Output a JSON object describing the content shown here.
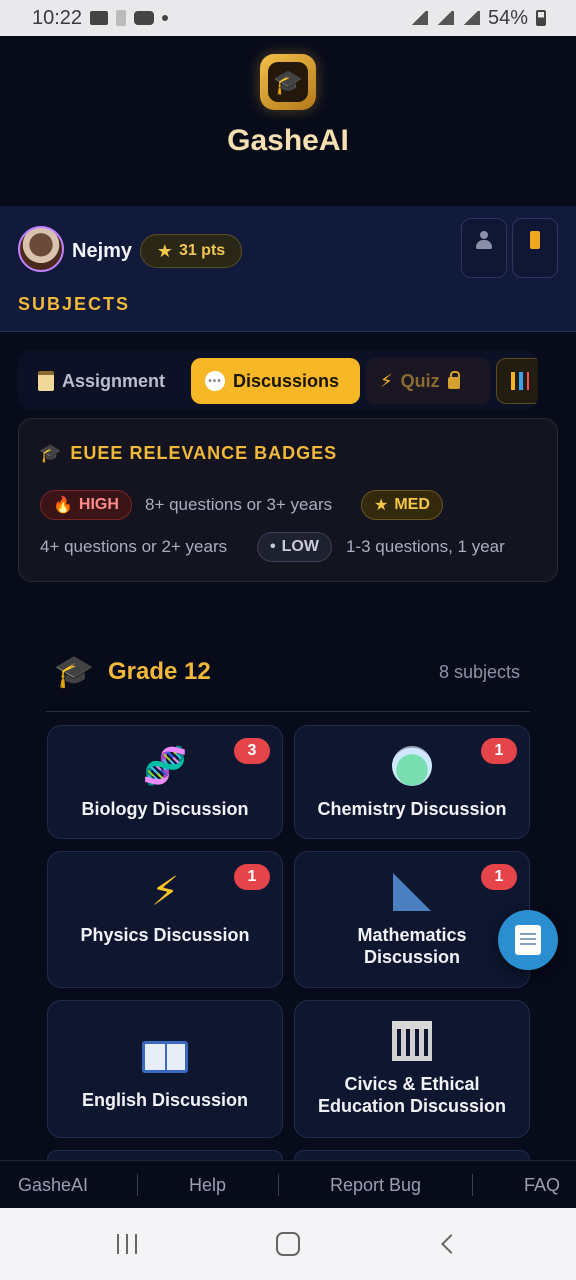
{
  "status_bar": {
    "time": "10:22",
    "battery": "54%"
  },
  "app": {
    "title": "GasheAI"
  },
  "user": {
    "name": "Nejmy",
    "points": "31 pts"
  },
  "section": {
    "label": "SUBJECTS"
  },
  "tabs": [
    {
      "label": "Assignment",
      "icon": "clipboard-icon"
    },
    {
      "label": "Discussions",
      "icon": "speech-bubble-icon",
      "active": true
    },
    {
      "label": "Quiz",
      "icon": "lightning-icon",
      "locked": true
    },
    {
      "label": "",
      "icon": "bar-chart-icon"
    }
  ],
  "relevance": {
    "title": "EUEE RELEVANCE BADGES",
    "high_label": "HIGH",
    "high_desc": "8+ questions or 3+ years",
    "med_label": "MED",
    "med_desc": "4+ questions or 2+ years",
    "low_label": "LOW",
    "low_desc": "1-3 questions, 1 year"
  },
  "grade": {
    "title": "Grade 12",
    "count": "8 subjects"
  },
  "subjects": [
    {
      "title": "Biology Discussion",
      "badge": "3",
      "icon": "dna-icon"
    },
    {
      "title": "Chemistry Discussion",
      "badge": "1",
      "icon": "flask-icon"
    },
    {
      "title": "Physics Discussion",
      "badge": "1",
      "icon": "lightning-icon"
    },
    {
      "title": "Mathematics Discussion",
      "badge": "1",
      "icon": "triangle-ruler-icon"
    },
    {
      "title": "English Discussion",
      "badge": "",
      "icon": "open-book-icon"
    },
    {
      "title": "Civics & Ethical Education Discussion",
      "badge": "",
      "icon": "classical-building-icon"
    }
  ],
  "footer": {
    "items": [
      "GasheAI",
      "Help",
      "Report Bug",
      "FAQ"
    ]
  },
  "colors": {
    "accent": "#f6b826",
    "background": "#070b1a",
    "badge_red": "#e5454a"
  }
}
